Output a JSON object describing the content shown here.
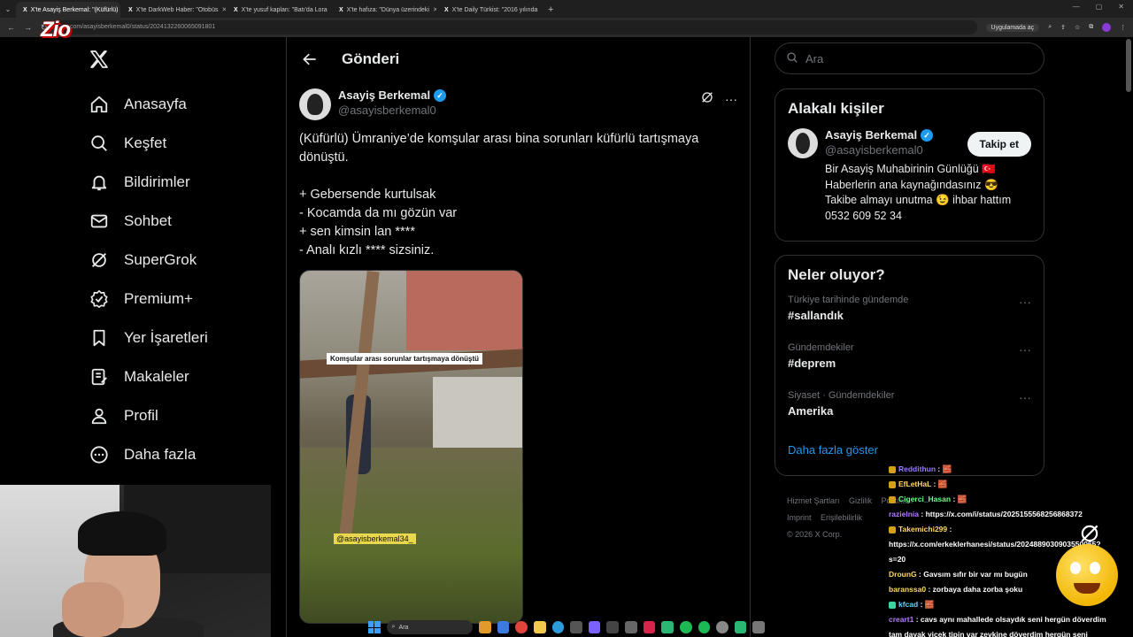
{
  "browser": {
    "tabs": [
      {
        "label": "X'te Asayiş Berkemal: \"(Küfürlü)",
        "active": true
      },
      {
        "label": "X'te DarkWeb Haber: \"Otobüs",
        "active": false
      },
      {
        "label": "X'te yusuf kaplan: \"Batı'da Lora",
        "active": false
      },
      {
        "label": "X'te hafıza: \"Dünya üzerindeki",
        "active": false
      },
      {
        "label": "X'te Daily Türkist: \"2016 yılında",
        "active": false
      }
    ],
    "tab_fav": "X",
    "url": "x.com/asayisberkemal0/status/2024132260065091801",
    "open_app_label": "Uygulamada aç",
    "stream_logo": "Zio"
  },
  "nav": {
    "items": [
      {
        "label": "Anasayfa",
        "icon": "home-icon"
      },
      {
        "label": "Keşfet",
        "icon": "search-icon"
      },
      {
        "label": "Bildirimler",
        "icon": "bell-icon"
      },
      {
        "label": "Sohbet",
        "icon": "mail-icon"
      },
      {
        "label": "SuperGrok",
        "icon": "grok-icon"
      },
      {
        "label": "Premium+",
        "icon": "verified-badge-icon"
      },
      {
        "label": "Yer İşaretleri",
        "icon": "bookmark-icon"
      },
      {
        "label": "Makaleler",
        "icon": "article-icon"
      },
      {
        "label": "Profil",
        "icon": "person-icon"
      },
      {
        "label": "Daha fazla",
        "icon": "more-circle-icon"
      }
    ]
  },
  "main": {
    "title": "Gönderi",
    "post": {
      "author_name": "Asayiş Berkemal",
      "author_handle": "@asayisberkemal0",
      "text_lines": [
        "(Küfürlü) Ümraniye’de komşular arası bina sorunları küfürlü tartışmaya dönüştü.",
        "",
        "+ Gebersende kurtulsak",
        "- Kocamda da mı gözün var",
        "+ sen kimsin lan ****",
        "- Analı kızlı **** sizsiniz."
      ],
      "media_caption": "Komşular arası sorunlar tartışmaya dönüştü",
      "media_watermark": "@asayisberkemal34_"
    }
  },
  "right": {
    "search_placeholder": "Ara",
    "related": {
      "title": "Alakalı kişiler",
      "name": "Asayiş Berkemal",
      "handle": "@asayisberkemal0",
      "bio_lines": [
        "Bir Asayiş Muhabirinin Günlüğü 🇹🇷",
        "Haberlerin ana kaynağındasınız 😎",
        "Takibe almayı unutma 😉 ihbar hattım",
        "0532 609 52 34"
      ],
      "follow_label": "Takip et"
    },
    "trends": {
      "title": "Neler oluyor?",
      "items": [
        {
          "meta": "Türkiye tarihinde gündemde",
          "name": "#sallandık"
        },
        {
          "meta": "Gündemdekiler",
          "name": "#deprem"
        },
        {
          "meta": "Siyaset · Gündemdekiler",
          "name": "Amerika"
        }
      ],
      "show_more": "Daha fazla göster"
    },
    "footer": {
      "links": [
        "Hizmet Şartları",
        "Gizlilik",
        "Politikası",
        "Imprint",
        "Erişilebilirlik"
      ],
      "copyright": "© 2026 X Corp."
    }
  },
  "chat": {
    "messages": [
      {
        "user": "Reddithun",
        "color": "#9b7bff",
        "text": ": 🧱"
      },
      {
        "user": "EfLetHaL",
        "color": "#ffd86b",
        "text": ": 🧱"
      },
      {
        "user": "Cigerci_Hasan",
        "color": "#6bff8a",
        "text": ": 🧱"
      },
      {
        "user": "razielnia",
        "color": "#b57bff",
        "text": ": https://x.com/i/status/2025155568256868372"
      },
      {
        "user": "Takemichi299",
        "color": "#ffd86b",
        "text": ":"
      },
      {
        "user": "",
        "color": "#ffffff",
        "text": "https://x.com/erkeklerhanesi/status/2024889030903550065?"
      },
      {
        "user": "",
        "color": "#ffffff",
        "text": "s=20"
      },
      {
        "user": "DrounG",
        "color": "#ffd86b",
        "text": ": Gavsım sıfır bir var mı bugün"
      },
      {
        "user": "baranssa0",
        "color": "#ffd86b",
        "text": ": zorbaya daha zorba şoku"
      },
      {
        "user": "kfcad",
        "color": "#6bd2ff",
        "text": ": 🧱"
      },
      {
        "user": "creart1",
        "color": "#b57bff",
        "text": ": cavs aynı mahallede olsaydık seni hergün döverdim"
      },
      {
        "user": "",
        "color": "#ffffff",
        "text": "tam dayak yicek tipin var zevkine döverdim hergün seni"
      }
    ]
  },
  "taskbar": {
    "search_placeholder": "Ara"
  }
}
